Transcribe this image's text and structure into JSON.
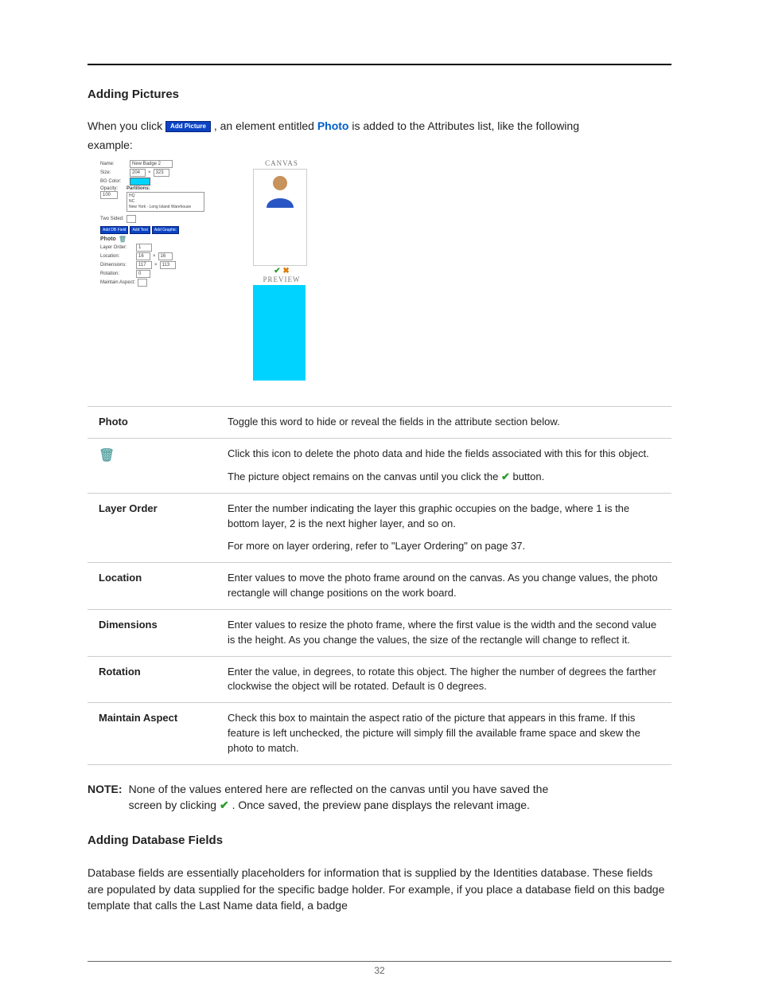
{
  "headings": {
    "h1": "Adding Pictures",
    "h2": "Adding Database Fields"
  },
  "intro": {
    "pre": "When you click",
    "btn": "Add Picture",
    "mid": ", an element entitled",
    "link": "Photo",
    "post": "is added to the Attributes list, like the following",
    "line2": "example:"
  },
  "mock": {
    "name_lbl": "Name:",
    "name_val": "New Badge 2",
    "size_lbl": "Size:",
    "size_w": "204",
    "size_h": "323",
    "bgcolor_lbl": "BG Color:",
    "opacity_lbl": "Opacity:",
    "opacity_val": "100",
    "partitions_lbl": "Partitions:",
    "partitions": [
      "HQ",
      "NC",
      "New York - Long Island Warehouse"
    ],
    "twosided_lbl": "Two Sided:",
    "btns": [
      "Add DB Field",
      "Add Text",
      "Add Graphic"
    ],
    "photo_lbl": "Photo",
    "layerorder_lbl": "Layer Order:",
    "layerorder_val": "1",
    "location_lbl": "Location:",
    "loc_x": "16",
    "loc_y": "16",
    "dimensions_lbl": "Dimensions:",
    "dim_w": "117",
    "dim_h": "113",
    "rotation_lbl": "Rotation:",
    "rotation_val": "0",
    "maintain_lbl": "Maintain Aspect:",
    "canvas_title": "CANVAS",
    "preview_title": "PREVIEW"
  },
  "table": {
    "rows": [
      {
        "label": "Photo",
        "body": [
          "Toggle this word to hide or reveal the fields in the attribute section below."
        ]
      },
      {
        "label": "__ICON__",
        "body": [
          "Click this icon to delete the photo data and hide the fields associated with this for this object.",
          "The picture object remains on the canvas until you click the __CHECK__ button."
        ]
      },
      {
        "label": "Layer Order",
        "body": [
          "Enter the number indicating the layer this graphic occupies on the badge, where 1 is the bottom layer, 2 is the next higher layer, and so on.",
          "For more on layer ordering, refer to \"Layer Ordering\" on page 37."
        ]
      },
      {
        "label": "Location",
        "body": [
          "Enter values to move the photo frame around on the canvas. As you change values, the photo rectangle will change positions on the work board."
        ]
      },
      {
        "label": "Dimensions",
        "body": [
          "Enter values to resize the photo frame, where the first value is the width and the second value is the height. As you change the values, the size of the rectangle will change to reflect it."
        ]
      },
      {
        "label": "Rotation",
        "body": [
          "Enter the value, in degrees, to rotate this object. The higher the number of degrees the farther clockwise the object will be rotated. Default is 0 degrees."
        ]
      },
      {
        "label": "Maintain Aspect",
        "body": [
          "Check this box to maintain the aspect ratio of the picture that appears in this frame. If this feature is left unchecked, the picture will simply fill the available frame space and skew the photo to match."
        ]
      }
    ]
  },
  "note": {
    "label": "NOTE:",
    "l1a": "None of the values entered here are reflected on the canvas until you have saved the",
    "l2a": "screen by clicking",
    "l2b": ". Once saved, the preview pane displays the relevant image."
  },
  "db_para": "Database fields are essentially placeholders for information that is supplied by the Identities database. These fields are populated by data supplied for the specific badge holder. For example, if you place a database field on this badge template that calls the Last Name data field, a badge",
  "page_no": "32"
}
